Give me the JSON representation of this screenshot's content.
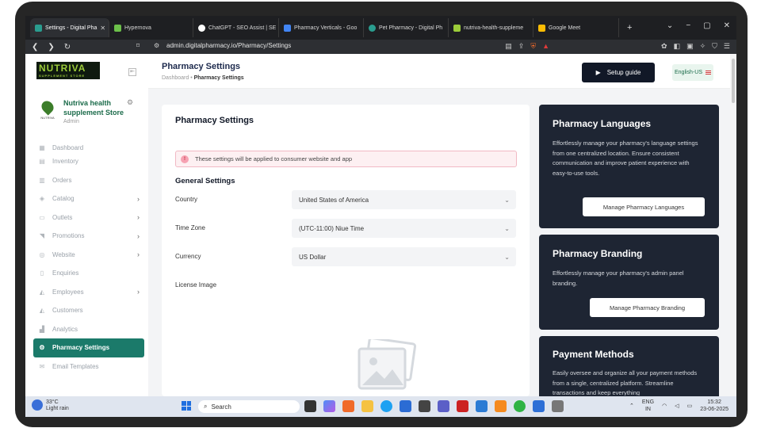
{
  "browser": {
    "tabs": [
      {
        "label": "Settings - Digital Pha",
        "color": "#2a9d8f",
        "active": true
      },
      {
        "label": "Hypernova",
        "color": "#6cc04a"
      },
      {
        "label": "ChatGPT - SEO Assist | SE",
        "color": "#ffffff"
      },
      {
        "label": "Pharmacy Verticals - Goo",
        "color": "#4285f4"
      },
      {
        "label": "Pet Pharmacy - Digital Ph",
        "color": "#2a9d8f"
      },
      {
        "label": "nutriva-health-suppleme",
        "color": "#9ccc3a"
      },
      {
        "label": "Google Meet",
        "color": "#fbbc04"
      }
    ],
    "url": "admin.digitalpharmacy.io/Pharmacy/Settings",
    "new_tab": "+",
    "close_tab": "✕",
    "nav": {
      "back": "❮",
      "forward": "❯",
      "reload": "↻"
    }
  },
  "sidebar": {
    "logo": "NUTRIVA",
    "logo_tagline": "SUPPLEMENT STORE",
    "store_name": "Nutriva health supplement Store",
    "store_role": "Admin",
    "store_logo_text": "NUTRIVA",
    "items": [
      {
        "label": "Dashboard",
        "icon": "▦",
        "chevron": false
      },
      {
        "label": "Inventory",
        "icon": "▤",
        "chevron": false
      },
      {
        "label": "Orders",
        "icon": "▥",
        "chevron": false
      },
      {
        "label": "Catalog",
        "icon": "◈",
        "chevron": true
      },
      {
        "label": "Outlets",
        "icon": "▭",
        "chevron": true
      },
      {
        "label": "Promotions",
        "icon": "◥",
        "chevron": true
      },
      {
        "label": "Website",
        "icon": "◎",
        "chevron": true
      },
      {
        "label": "Enquiries",
        "icon": "▯",
        "chevron": false
      },
      {
        "label": "Employees",
        "icon": "◭",
        "chevron": true
      },
      {
        "label": "Customers",
        "icon": "◭",
        "chevron": false
      },
      {
        "label": "Analytics",
        "icon": "▟",
        "chevron": false
      },
      {
        "label": "Pharmacy Settings",
        "icon": "⚙",
        "chevron": false,
        "active": true
      },
      {
        "label": "Email Templates",
        "icon": "✉",
        "chevron": false
      }
    ]
  },
  "header": {
    "title": "Pharmacy Settings",
    "breadcrumb_root": "Dashboard",
    "breadcrumb_sep": "•",
    "breadcrumb_current": "Pharmacy Settings",
    "setup_label": "Setup guide",
    "language": "English-US"
  },
  "main": {
    "title": "Pharmacy Settings",
    "alert": "These settings will be applied to consumer website and app",
    "section_title": "General Settings",
    "fields": {
      "country_label": "Country",
      "country_value": "United States of America",
      "timezone_label": "Time Zone",
      "timezone_value": "(UTC-11:00) Niue Time",
      "currency_label": "Currency",
      "currency_value": "US Dollar",
      "license_label": "License Image"
    }
  },
  "side_cards": {
    "languages": {
      "title": "Pharmacy Languages",
      "desc": "Effortlessly manage your pharmacy's language settings from one centralized location. Ensure consistent communication and improve patient experience with easy-to-use tools.",
      "button": "Manage Pharmacy Languages"
    },
    "branding": {
      "title": "Pharmacy Branding",
      "desc": "Effortlessly manage your pharmacy's admin panel branding.",
      "button": "Manage Pharmacy Branding"
    },
    "payment": {
      "title": "Payment Methods",
      "desc": "Easily oversee and organize all your payment methods from a single, centralized platform. Streamline transactions and keep everything"
    }
  },
  "taskbar": {
    "temperature": "33°C",
    "weather": "Light rain",
    "weather_badge": "4",
    "search": "Search",
    "lang_line1": "ENG",
    "lang_line2": "IN",
    "time": "15:32",
    "date": "23-06-2025"
  }
}
